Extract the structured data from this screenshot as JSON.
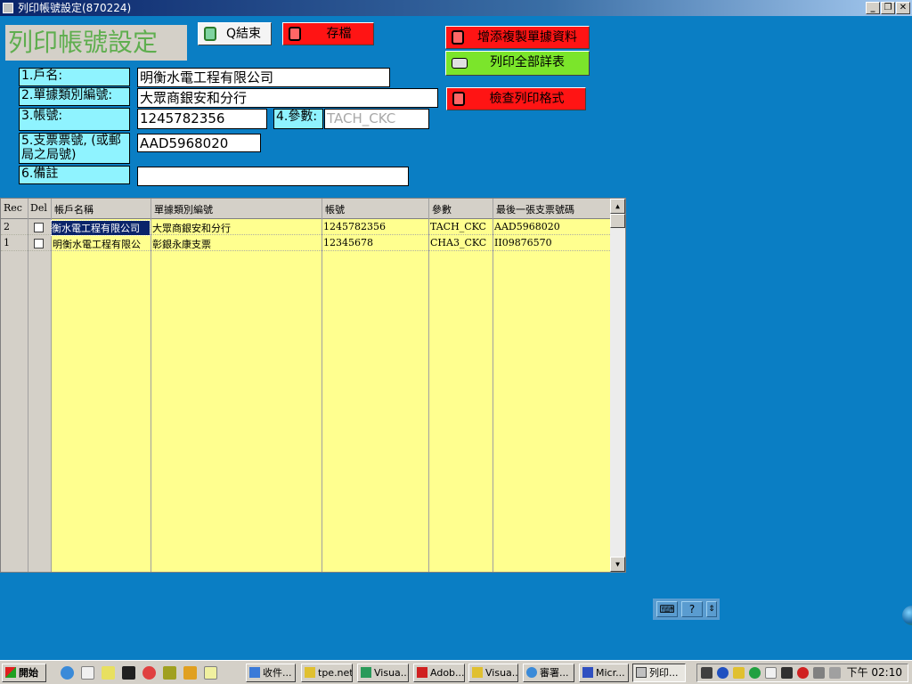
{
  "window": {
    "title": "列印帳號設定(870224)"
  },
  "form": {
    "big_title": "列印帳號設定",
    "btn_exit": "Q結束",
    "btn_save": "存檔",
    "btn_copy": "增添複製單據資料",
    "btn_print_all": "列印全部詳表",
    "btn_check": "檢查列印格式",
    "fields": {
      "account_name_label": "1.戶名:",
      "account_name_value": "明衡水電工程有限公司",
      "doc_type_label": "2.單據類別編號:",
      "doc_type_value": "大眾商銀安和分行",
      "account_no_label": "3.帳號:",
      "account_no_value": "1245782356",
      "param_label": "4.參數:",
      "param_value": "TACH_CKC",
      "cheque_label": "5.支票票號, (或郵局之局號)",
      "cheque_value": "AAD5968020",
      "note_label": "6.備註",
      "note_value": ""
    }
  },
  "grid": {
    "headers": {
      "rec": "Rec",
      "del": "Del",
      "account_name": "帳戶名稱",
      "doc_type": "單據類別編號",
      "account_no": "帳號",
      "param": "參數",
      "last_cheque": "最後一張支票號碼"
    },
    "rows": [
      {
        "rec": "2",
        "account_name": "衡水電工程有限公司",
        "doc_type": "大眾商銀安和分行",
        "account_no": "1245782356",
        "param": "TACH_CKC",
        "last_cheque": "AAD5968020"
      },
      {
        "rec": "1",
        "account_name": "明衡水電工程有限公",
        "doc_type": "彰銀永康支票",
        "account_no": "12345678",
        "param": "CHA3_CKC",
        "last_cheque": "II09876570"
      }
    ]
  },
  "taskbar": {
    "start": "開始",
    "tasks": [
      "收件...",
      "tpe.net",
      "Visua...",
      "Adob...",
      "Visua...",
      "審署...",
      "Micr...",
      "列印..."
    ],
    "clock": "下午 02:10"
  },
  "colors": {
    "desktop": "#0a7ec4",
    "label_bg": "#8ff3ff",
    "red_button": "#ff1414",
    "green_button": "#7be52b",
    "grid_bg": "#ffff8f",
    "title_green": "#5fae4f"
  }
}
